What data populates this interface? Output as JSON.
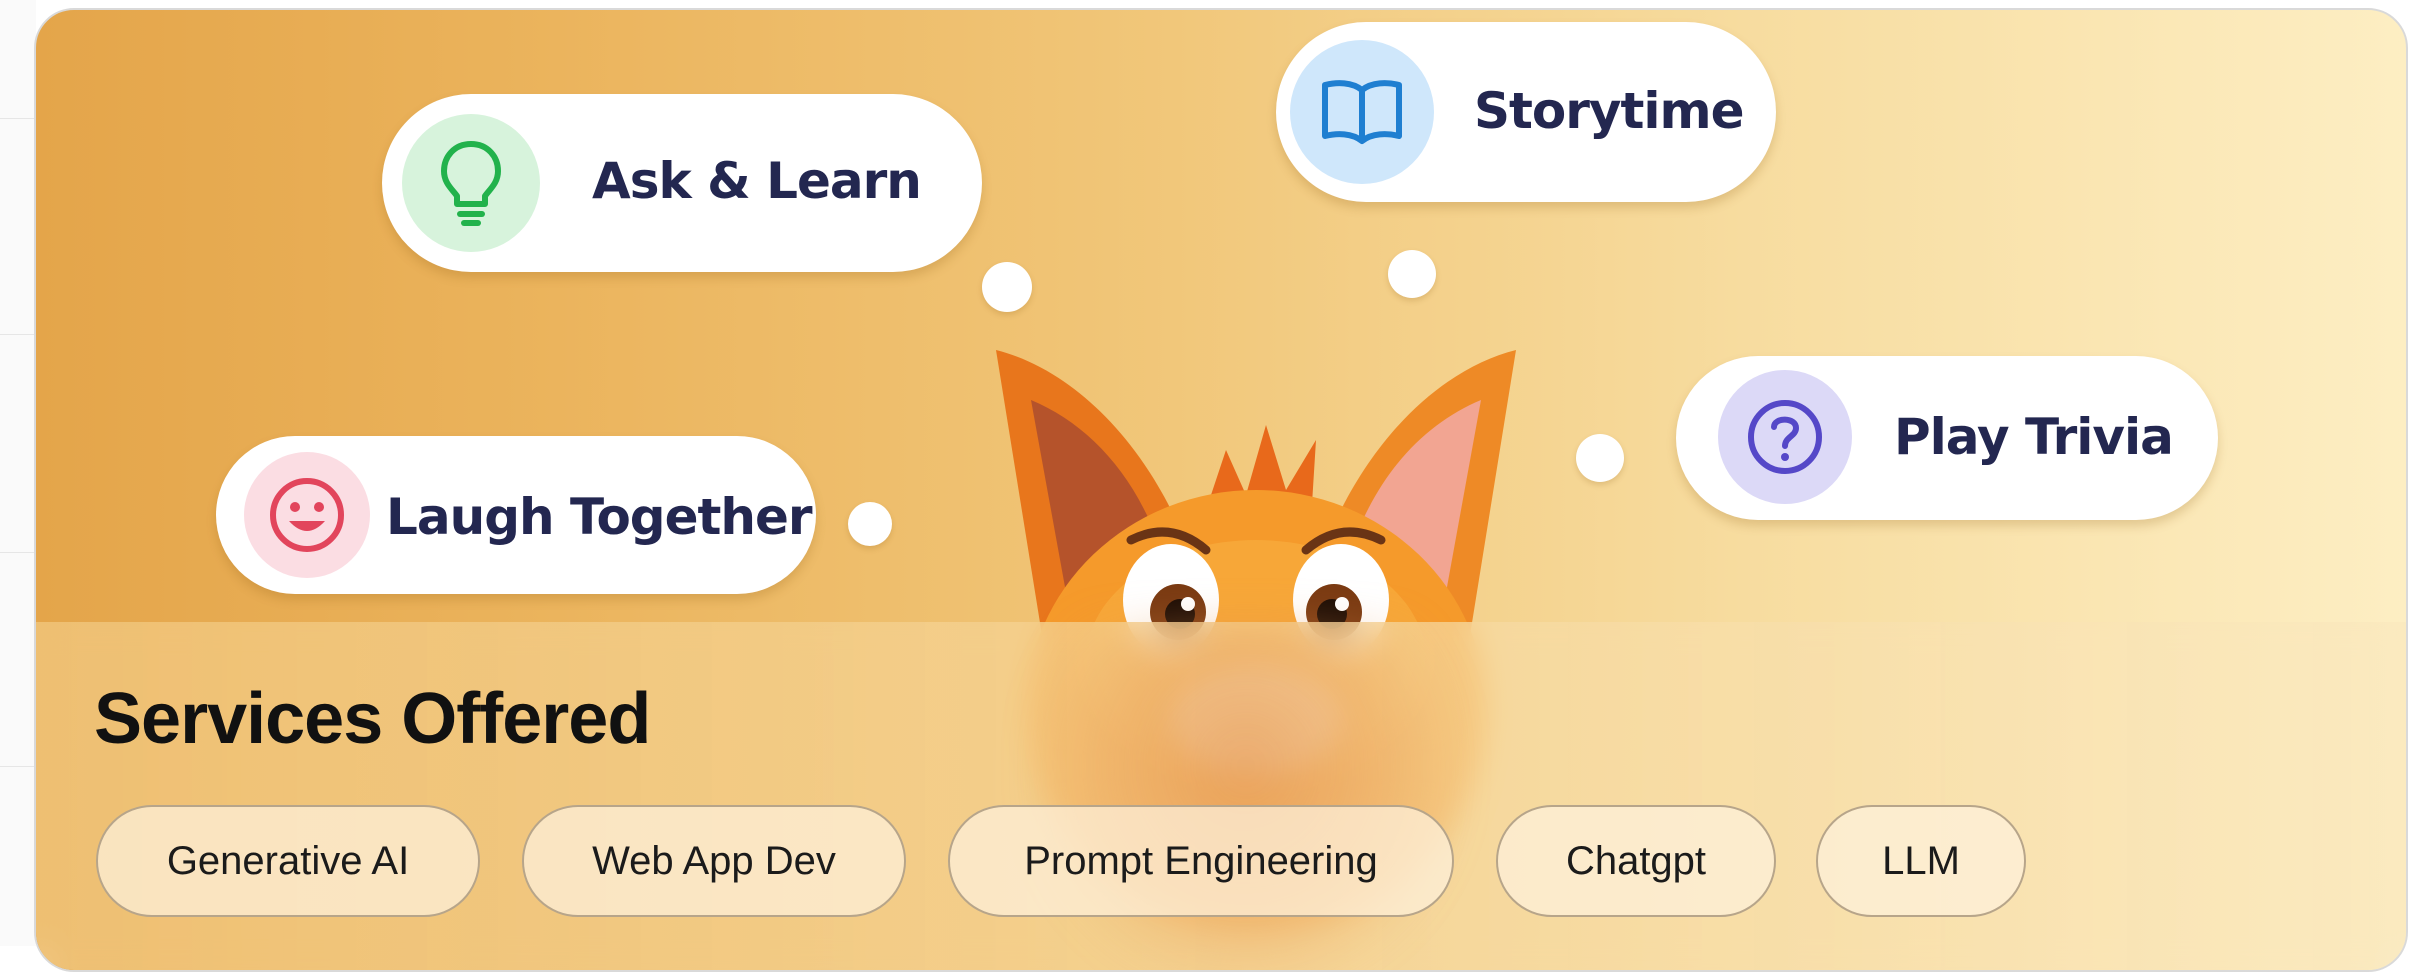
{
  "banner": {
    "bubbles": [
      {
        "label": "Ask & Learn",
        "icon": "lightbulb-icon",
        "icon_bg": "#d7f3dc",
        "icon_color": "#22b24c"
      },
      {
        "label": "Storytime",
        "icon": "book-icon",
        "icon_bg": "#cfe7fb",
        "icon_color": "#1f7fd1"
      },
      {
        "label": "Play Trivia",
        "icon": "question-circle-icon",
        "icon_bg": "#dcd9f7",
        "icon_color": "#5548c8"
      },
      {
        "label": "Laugh Together",
        "icon": "smile-icon",
        "icon_bg": "#fbdde3",
        "icon_color": "#e2455c"
      }
    ]
  },
  "services": {
    "title": "Services Offered",
    "chips": [
      "Generative AI",
      "Web App Dev",
      "Prompt Engineering",
      "Chatgpt",
      "LLM"
    ]
  }
}
